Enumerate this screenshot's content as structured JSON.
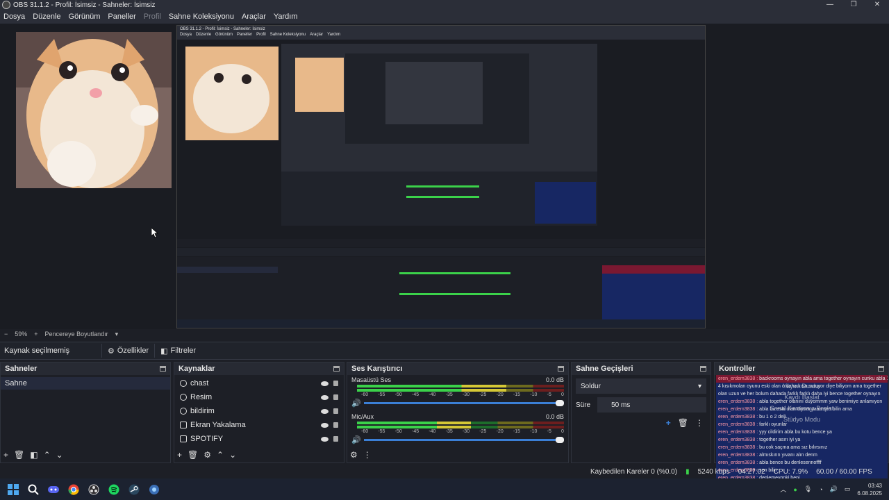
{
  "window": {
    "title": "OBS 31.1.2 - Profil: İsimsiz - Sahneler: İsimsiz",
    "minimize": "—",
    "maximize": "❐",
    "close": "✕"
  },
  "menu": [
    "Dosya",
    "Düzenle",
    "Görünüm",
    "Paneller",
    "Profil",
    "Sahne Koleksiyonu",
    "Araçlar",
    "Yardım"
  ],
  "status_strip": {
    "minus": "−",
    "zoom": "59%",
    "plus": "+",
    "fit": "Pencereye Boyutlandır"
  },
  "source_bar": {
    "label": "Kaynak seçilmemiş",
    "properties": "Özellikler",
    "filters": "Filtreler"
  },
  "docks": {
    "scenes": {
      "title": "Sahneler",
      "items": [
        "Sahne"
      ]
    },
    "sources": {
      "title": "Kaynaklar",
      "items": [
        {
          "name": "chast",
          "icon": "globe-icon"
        },
        {
          "name": "Resim",
          "icon": "image-icon"
        },
        {
          "name": "bildirim",
          "icon": "globe-icon"
        },
        {
          "name": "Ekran Yakalama",
          "icon": "monitor-icon"
        },
        {
          "name": "SPOTIFY",
          "icon": "window-icon"
        }
      ]
    },
    "mixer": {
      "title": "Ses Karıştırıcı",
      "channels": [
        {
          "name": "Masaüstü Ses",
          "level": "0.0 dB",
          "fill": 0.72
        },
        {
          "name": "Mic/Aux",
          "level": "0.0 dB",
          "fill": 0.55
        }
      ],
      "scale": [
        "-60",
        "-55",
        "-50",
        "-45",
        "-40",
        "-35",
        "-30",
        "-25",
        "-20",
        "-15",
        "-10",
        "-5",
        "0"
      ]
    },
    "transitions": {
      "title": "Sahne Geçişleri",
      "selected": "Soldur",
      "duration_label": "Süre",
      "duration_value": "50 ms"
    },
    "controls": {
      "title": "Kontroller",
      "overlay": [
        "Yayını Durdur",
        "Kaydı Başlat",
        "Sanal Kamerayı Başlat",
        "Stüdyo Modu"
      ]
    }
  },
  "chat": [
    {
      "user": "eren_erdem3838 :",
      "msg": "backrooms oynayın abla ama together oynayın cunku abla 1",
      "style": "a"
    },
    {
      "user": "",
      "msg": "4 kısıkmolan oyunu eski olan o daha kısa suruyor diye biliyom ama together",
      "style": "b"
    },
    {
      "user": "",
      "msg": "olan uzun ve her bolum dahada farklı farklı daha iyi bence together oynayın",
      "style": "b"
    },
    {
      "user": "eren_erdem3838 :",
      "msg": "abla together olanını duyommm yaw benimiye anlamıyon",
      "style": "b"
    },
    {
      "user": "eren_erdem3838 :",
      "msg": "abla bu eski olan diyom yaaa sen bilin ama",
      "style": "b"
    },
    {
      "user": "eren_erdem3838 :",
      "msg": "bu 1 o 2 deli",
      "style": "b"
    },
    {
      "user": "eren_erdem3838 :",
      "msg": "farklı oyunlar",
      "style": "b"
    },
    {
      "user": "eren_erdem3838 :",
      "msg": "yyy cildirim abla bu kotu bence ya",
      "style": "b"
    },
    {
      "user": "eren_erdem3838 :",
      "msg": "together asırı iyi ya",
      "style": "b"
    },
    {
      "user": "eren_erdem3838 :",
      "msg": "bu cok saçma ama sız bılırsınız",
      "style": "b"
    },
    {
      "user": "eren_erdem3838 :",
      "msg": "almıskırın yıvanı alın denm",
      "style": "b"
    },
    {
      "user": "eren_erdem3838 :",
      "msg": "abla bence bu denlesennoffff",
      "style": "b"
    },
    {
      "user": "eren_erdem3838 :",
      "msg": "sen bilin",
      "style": "b"
    },
    {
      "user": "eren_erdem3838 :",
      "msg": "denlemeyonki beni",
      "style": "b"
    },
    {
      "user": "eren_erdem3838 :",
      "msg": "görusunuz abla",
      "style": "b"
    },
    {
      "user": "eren_erdem3838 :",
      "msg": "euku olan kotu dedum",
      "style": "b"
    }
  ],
  "stats": {
    "dropped": "Kaybedilen Kareler 0 (%0.0)",
    "bitrate": "5240 kbps",
    "time": "04:27:02",
    "cpu": "CPU: 7.9%",
    "fps": "60.00 / 60.00 FPS"
  },
  "taskbar": {
    "icons": [
      "windows-start-icon",
      "search-icon",
      "discord-icon",
      "chrome-icon",
      "obs-icon",
      "spotify-icon",
      "steam-icon",
      "app-icon"
    ],
    "clock_time": "03:43",
    "clock_date": "6.08.2025"
  },
  "colors": {
    "accent": "#3b7fd6",
    "chat_highlight": "#7a1831",
    "chat_bg": "#172763"
  }
}
